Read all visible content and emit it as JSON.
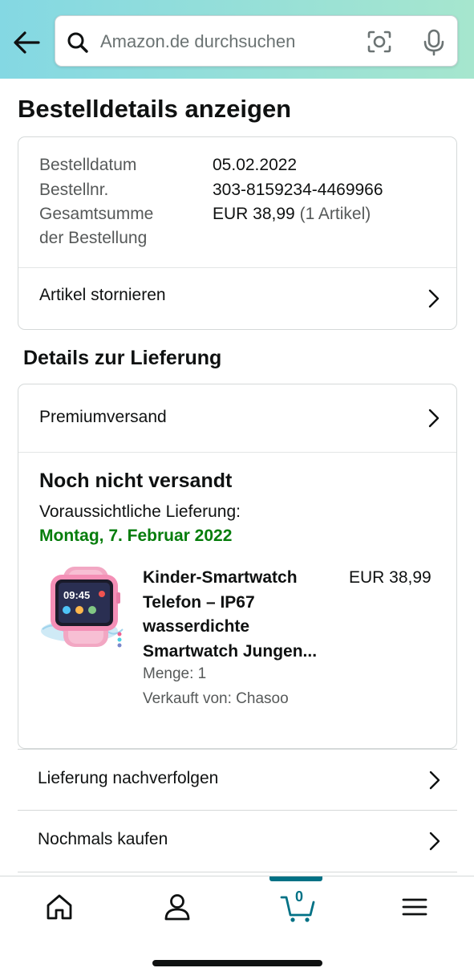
{
  "header": {
    "search_placeholder": "Amazon.de durchsuchen",
    "background_gradient": [
      "#84d8e3",
      "#a6e6ce"
    ]
  },
  "page_title": "Bestelldetails anzeigen",
  "order_summary": {
    "date_label": "Bestelldatum",
    "date_value": "05.02.2022",
    "number_label": "Bestellnr.",
    "number_value": "303-8159234-4469966",
    "total_label_line1": "Gesamtsumme",
    "total_label_line2": "der Bestellung",
    "total_value": "EUR 38,99",
    "total_items": "(1 Artikel)",
    "cancel_label": "Artikel stornieren"
  },
  "delivery": {
    "section_title": "Details zur Lieferung",
    "shipping_method": "Premiumversand",
    "status": "Noch nicht versandt",
    "eta_label": "Voraussichtliche Lieferung:",
    "eta_date": "Montag, 7. Februar 2022",
    "product": {
      "title": "Kinder-Smartwatch Telefon – IP67 wasserdichte Smartwatch Jungen...",
      "price": "EUR 38,99",
      "quantity": "Menge: 1",
      "seller": "Verkauft von: Chasoo",
      "image_icon": "pink-kids-smartwatch-image"
    }
  },
  "actions": {
    "track": "Lieferung nachverfolgen",
    "buy_again": "Nochmals kaufen"
  },
  "bottom_nav": {
    "cart_count": "0",
    "accent_color": "#007185",
    "items": [
      "home-icon",
      "account-icon",
      "cart-icon",
      "menu-icon"
    ]
  },
  "colors": {
    "eta_green": "#067d0c",
    "muted_text": "#565959",
    "border": "#d5d9d9"
  }
}
